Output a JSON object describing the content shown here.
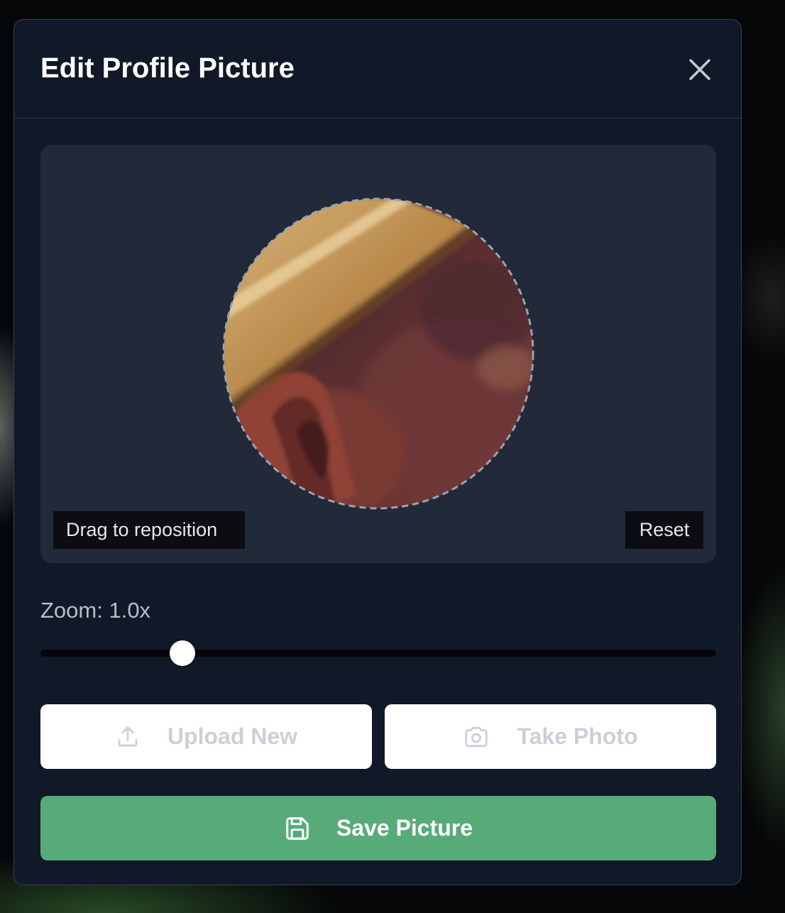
{
  "dialog": {
    "title": "Edit Profile Picture",
    "close_icon": "close-icon"
  },
  "editor": {
    "drag_hint": "Drag to reposition",
    "reset_label": "Reset"
  },
  "zoom": {
    "label": "Zoom: 1.0x",
    "value": 1.0,
    "slider_fraction": 0.21
  },
  "actions": {
    "upload_label": "Upload New",
    "upload_icon": "upload-icon",
    "photo_label": "Take Photo",
    "photo_icon": "camera-icon",
    "save_label": "Save Picture",
    "save_icon": "save-icon"
  },
  "colors": {
    "modal_bg": "#111827",
    "editor_bg": "#222938",
    "save_button": "#57ab78",
    "light_button_text": "#cbd0d8"
  }
}
